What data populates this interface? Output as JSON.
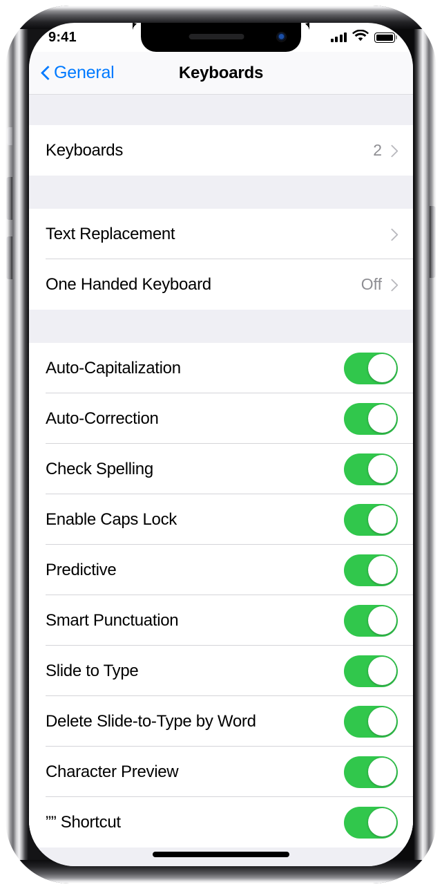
{
  "status_bar": {
    "time": "9:41",
    "signal_icon": "cellular-signal-icon",
    "wifi_icon": "wifi-icon",
    "battery_icon": "battery-full-icon"
  },
  "nav_bar": {
    "back_label": "General",
    "back_icon": "chevron-left-icon",
    "title": "Keyboards"
  },
  "colors": {
    "accent_blue": "#007aff",
    "toggle_on_green": "#31c74c",
    "group_background": "#efeff4",
    "row_background": "#ffffff",
    "secondary_text": "#8e8e93",
    "separator": "#d4d4d8"
  },
  "sections": [
    {
      "rows": [
        {
          "label": "Keyboards",
          "value": "2",
          "type": "disclosure",
          "accessory_icon": "chevron-right-icon"
        }
      ]
    },
    {
      "rows": [
        {
          "label": "Text Replacement",
          "value": "",
          "type": "disclosure",
          "accessory_icon": "chevron-right-icon"
        },
        {
          "label": "One Handed Keyboard",
          "value": "Off",
          "type": "disclosure",
          "accessory_icon": "chevron-right-icon"
        }
      ]
    },
    {
      "rows": [
        {
          "label": "Auto-Capitalization",
          "type": "toggle",
          "state": "on"
        },
        {
          "label": "Auto-Correction",
          "type": "toggle",
          "state": "on"
        },
        {
          "label": "Check Spelling",
          "type": "toggle",
          "state": "on"
        },
        {
          "label": "Enable Caps Lock",
          "type": "toggle",
          "state": "on"
        },
        {
          "label": "Predictive",
          "type": "toggle",
          "state": "on"
        },
        {
          "label": "Smart Punctuation",
          "type": "toggle",
          "state": "on"
        },
        {
          "label": "Slide to Type",
          "type": "toggle",
          "state": "on"
        },
        {
          "label": "Delete Slide-to-Type by Word",
          "type": "toggle",
          "state": "on"
        },
        {
          "label": "Character Preview",
          "type": "toggle",
          "state": "on"
        },
        {
          "label": "”” Shortcut",
          "type": "toggle",
          "state": "on"
        }
      ]
    }
  ],
  "device": {
    "silent_switch": "silent-switch",
    "volume_up": "volume-up-button",
    "volume_down": "volume-down-button",
    "power": "power-button",
    "home_indicator": "home-indicator"
  }
}
